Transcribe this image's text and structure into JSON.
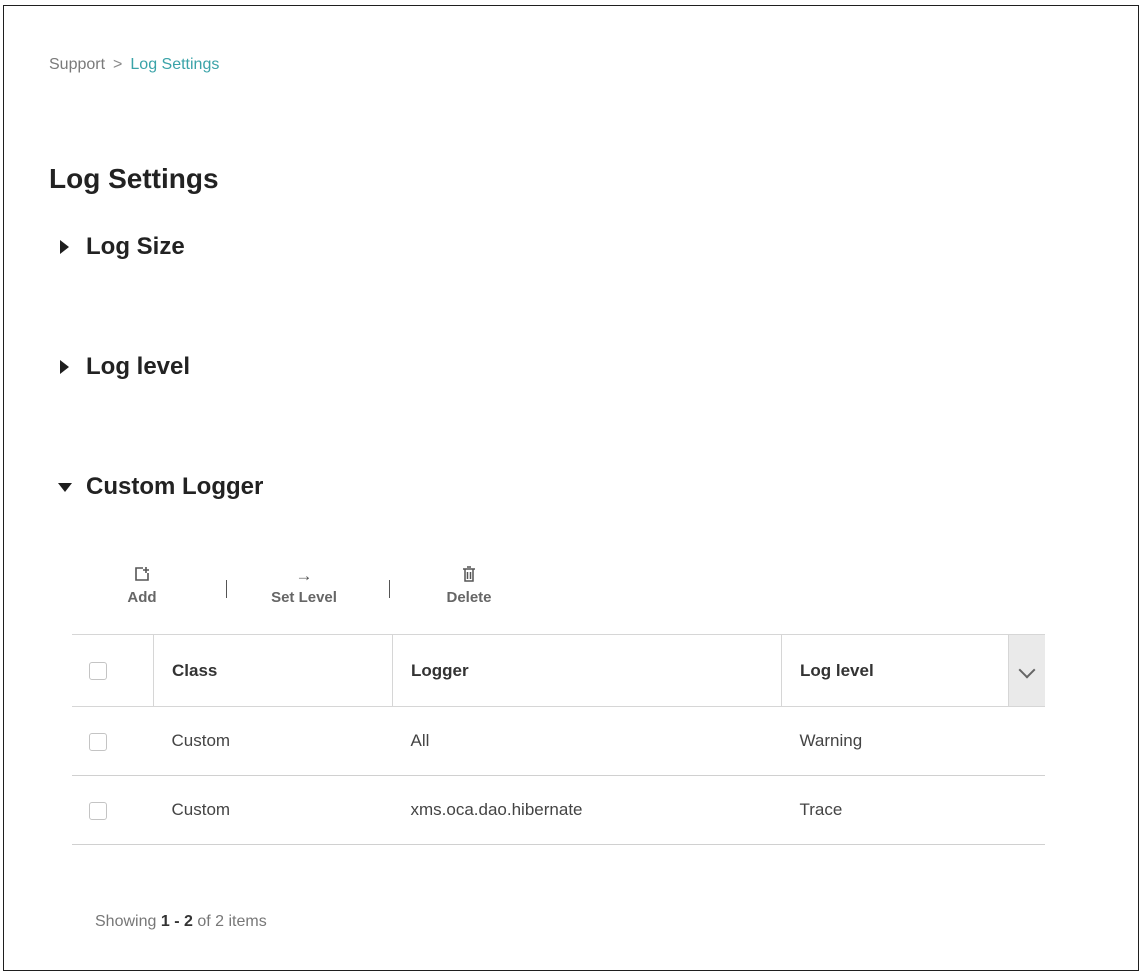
{
  "breadcrumb": {
    "root": "Support",
    "separator": ">",
    "current": "Log Settings"
  },
  "page_title": "Log Settings",
  "sections": {
    "log_size": {
      "label": "Log Size",
      "expanded": false
    },
    "log_level": {
      "label": "Log level",
      "expanded": false
    },
    "custom_logger": {
      "label": "Custom Logger",
      "expanded": true
    }
  },
  "toolbar": {
    "add_label": "Add",
    "add_icon": "add-icon",
    "set_level_label": "Set Level",
    "set_level_icon": "arrow-right-icon",
    "delete_label": "Delete",
    "delete_icon": "trash-icon"
  },
  "table": {
    "columns": [
      "Class",
      "Logger",
      "Log level"
    ],
    "rows": [
      {
        "class": "Custom",
        "logger": "All",
        "log_level": "Warning"
      },
      {
        "class": "Custom",
        "logger": "xms.oca.dao.hibernate",
        "log_level": "Trace"
      }
    ]
  },
  "footer": {
    "prefix": "Showing",
    "start": "1",
    "dash": "-",
    "end": "2",
    "of": "of",
    "total": "2",
    "suffix": "items"
  },
  "colors": {
    "accent": "#3aa3a8",
    "text": "#222222",
    "border": "#d6d6d6"
  }
}
